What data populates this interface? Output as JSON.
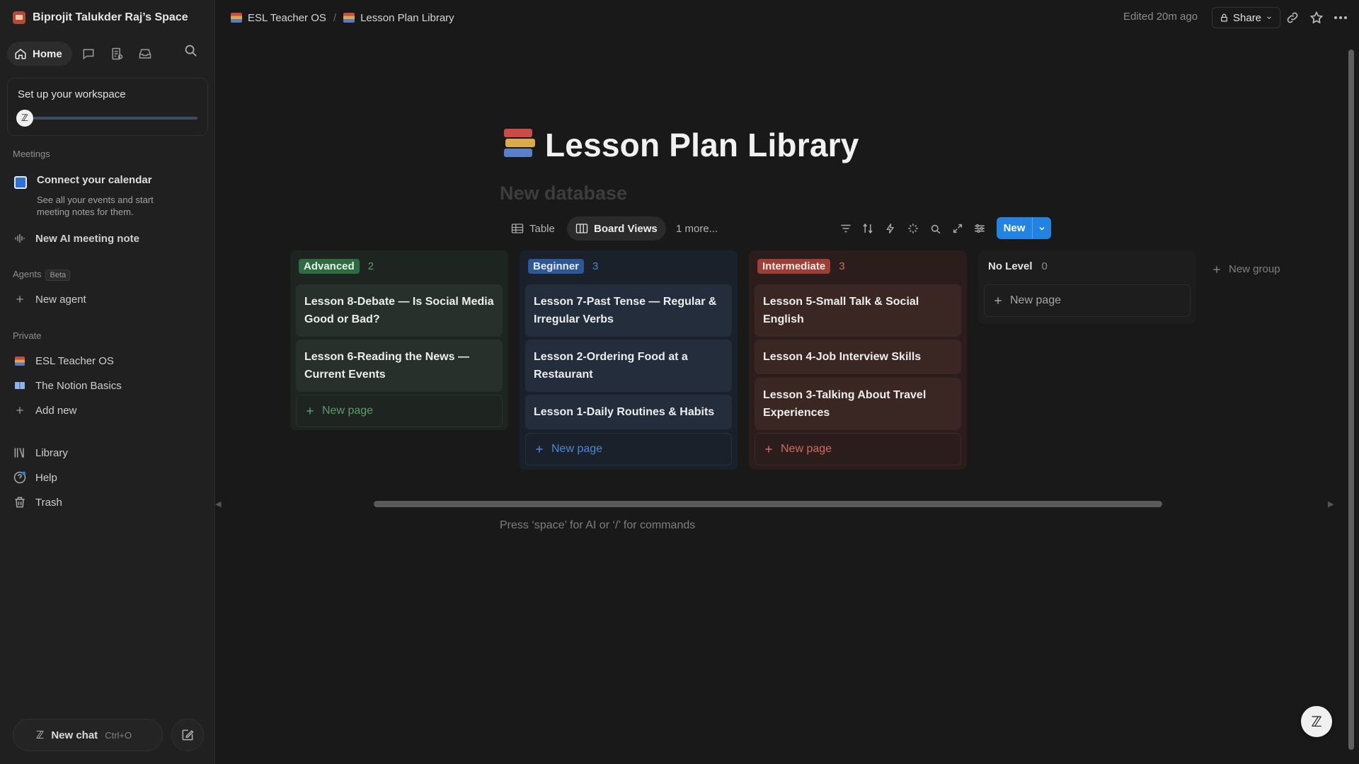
{
  "sidebar": {
    "workspace_name": "Biprojit Talukder Raj’s Space",
    "home_label": "Home",
    "setup": {
      "title": "Set up your workspace",
      "progress": 0.03
    },
    "meetings_label": "Meetings",
    "calendar": {
      "title": "Connect your calendar",
      "description": "See all your events and start meeting notes for them."
    },
    "new_ai_note": "New AI meeting note",
    "agents_label": "Agents",
    "agents_badge": "Beta",
    "new_agent": "New agent",
    "private_label": "Private",
    "private_items": [
      {
        "label": "ESL Teacher OS"
      },
      {
        "label": "The Notion Basics"
      }
    ],
    "add_new": "Add new",
    "library": "Library",
    "help": "Help",
    "trash": "Trash",
    "new_chat": "New chat",
    "new_chat_shortcut": "Ctrl+O"
  },
  "topbar": {
    "breadcrumbs": [
      "ESL Teacher OS",
      "Lesson Plan Library"
    ],
    "edited": "Edited 20m ago",
    "share": "Share"
  },
  "page": {
    "title": "Lesson Plan Library",
    "database_title": "New database",
    "hint": "Press ‘space’ for AI or ‘/’ for commands"
  },
  "views": {
    "tabs": [
      {
        "label": "Table"
      },
      {
        "label": "Board Views"
      }
    ],
    "more": "1 more...",
    "new_label": "New"
  },
  "board": {
    "new_page_label": "New page",
    "new_group_label": "New group",
    "columns": [
      {
        "name": "Advanced",
        "count": "2",
        "color": "#2f7a45",
        "cards": [
          "Lesson 8-Debate — Is Social Media Good or Bad?",
          "Lesson 6-Reading the News — Current Events"
        ]
      },
      {
        "name": "Beginner",
        "count": "3",
        "color": "#2e5a99",
        "cards": [
          "Lesson 7-Past Tense — Regular & Irregular Verbs",
          "Lesson 2-Ordering Food at a Restaurant",
          "Lesson 1-Daily Routines & Habits"
        ]
      },
      {
        "name": "Intermediate",
        "count": "3",
        "color": "#a3453b",
        "cards": [
          "Lesson 5-Small Talk & Social English",
          "Lesson 4-Job Interview Skills",
          "Lesson 3-Talking About Travel Experiences"
        ]
      },
      {
        "name": "No Level",
        "count": "0",
        "color": "#d9d9d9",
        "cards": []
      }
    ]
  }
}
